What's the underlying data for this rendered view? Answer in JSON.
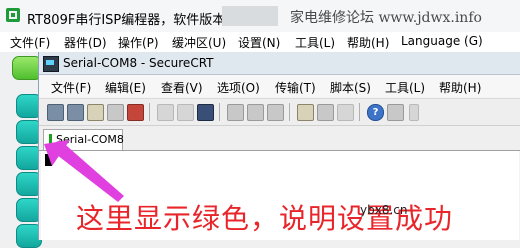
{
  "outer_window": {
    "title": "RT809F串行ISP编程器，软件版本：",
    "watermark": "家电维修论坛 www.jdwx.info",
    "menu": [
      "文件(F)",
      "器件(D)",
      "操作(P)",
      "缓冲区(U)",
      "设置(N)",
      "工具(L)",
      "帮助(H)",
      "Language (G)"
    ]
  },
  "crt_window": {
    "title": "Serial-COM8 - SecureCRT",
    "menu": [
      "文件(F)",
      "编辑(E)",
      "查看(V)",
      "选项(O)",
      "传输(T)",
      "脚本(S)",
      "工具(L)",
      "帮助(H)"
    ],
    "session_tab": "Serial-COM8",
    "tab_status_color": "#1aa31a"
  },
  "annotation": {
    "caption": "这里显示绿色，说明设置成功",
    "watermark2": "ybx8.cn",
    "arrow_color": "#e040e0"
  }
}
